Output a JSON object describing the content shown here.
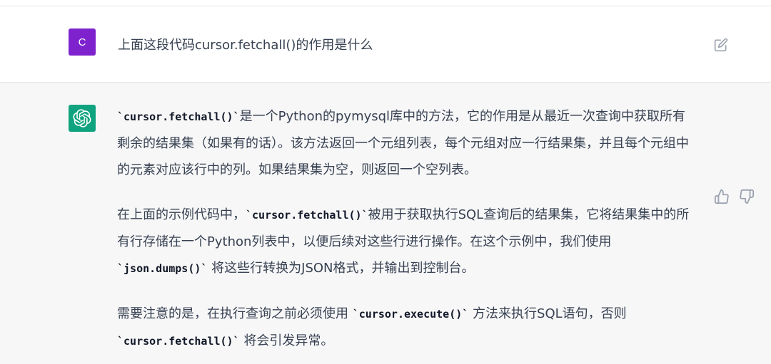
{
  "user_message": {
    "avatar_letter": "C",
    "text": "上面这段代码cursor.fetchall()的作用是什么",
    "avatar_color": "#7e22ce",
    "icons": {
      "edit": "edit-icon"
    }
  },
  "assistant_message": {
    "avatar_color": "#10a37f",
    "icons": {
      "avatar": "openai-logo-icon",
      "like": "thumbs-up-icon",
      "dislike": "thumbs-down-icon"
    },
    "paragraphs": [
      {
        "code1": "`cursor.fetchall()`",
        "text1": "是一个Python的pymysql库中的方法，它的作用是从最近一次查询中获取所有剩余的结果集（如果有的话）。该方法返回一个元组列表，每个元组对应一行结果集，并且每个元组中的元素对应该行中的列。如果结果集为空，则返回一个空列表。"
      },
      {
        "text1": "在上面的示例代码中，",
        "code1": "`cursor.fetchall()`",
        "text2": "被用于获取执行SQL查询后的结果集，它将结果集中的所有行存储在一个Python列表中，以便后续对这些行进行操作。在这个示例中，我们使用 ",
        "code2": "`json.dumps()`",
        "text3": " 将这些行转换为JSON格式，并输出到控制台。"
      },
      {
        "text1": "需要注意的是，在执行查询之前必须使用 ",
        "code1": "`cursor.execute()`",
        "text2": " 方法来执行SQL语句，否则 ",
        "code2": "`cursor.fetchall()`",
        "text3": " 将会引发异常。"
      }
    ]
  }
}
